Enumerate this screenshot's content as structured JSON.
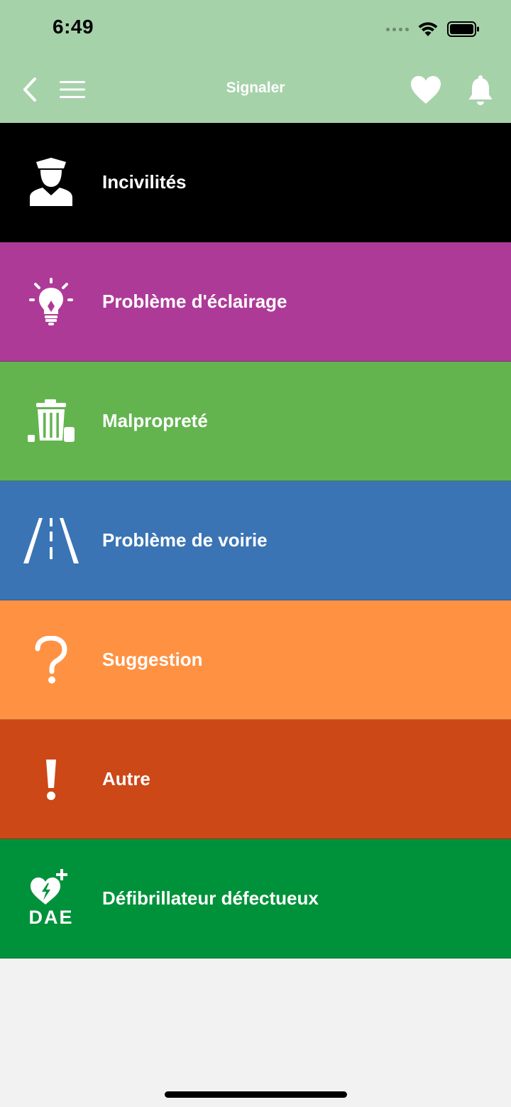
{
  "status_bar": {
    "time": "6:49"
  },
  "nav": {
    "title": "Signaler"
  },
  "items": [
    {
      "label": "Incivilités",
      "color": "#000000",
      "icon": "officer-icon"
    },
    {
      "label": "Problème d'éclairage",
      "color": "#ae3a98",
      "icon": "lightbulb-icon"
    },
    {
      "label": "Malpropreté",
      "color": "#63b44f",
      "icon": "trash-icon"
    },
    {
      "label": "Problème de voirie",
      "color": "#3a74b4",
      "icon": "road-icon"
    },
    {
      "label": "Suggestion",
      "color": "#ff9143",
      "icon": "question-icon"
    },
    {
      "label": "Autre",
      "color": "#cc4817",
      "icon": "exclamation-icon"
    },
    {
      "label": "Défibrillateur défectueux",
      "color": "#00923a",
      "icon": "defibrillator-icon",
      "icon_text": "DAE"
    }
  ]
}
